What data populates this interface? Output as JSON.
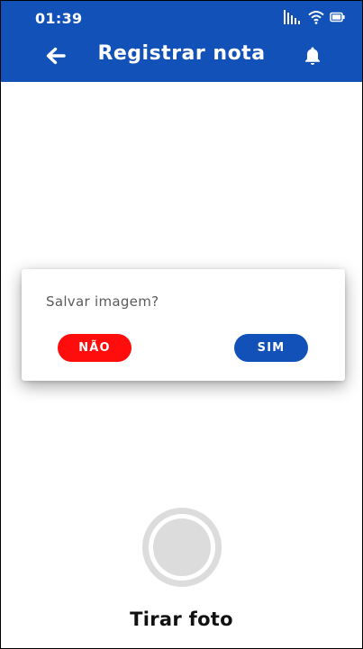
{
  "status_bar": {
    "time": "01:39",
    "icons": [
      "signal-icon",
      "wifi-icon",
      "battery-icon"
    ]
  },
  "app_bar": {
    "title": "Registrar nota",
    "back_icon": "arrow-left-icon",
    "notification_icon": "bell-icon",
    "background_color": "#1151b8"
  },
  "dialog": {
    "message": "Salvar imagem?",
    "buttons": {
      "no_label": "NÃO",
      "yes_label": "SIM"
    },
    "no_color": "#ff0d0d",
    "yes_color": "#1151b8"
  },
  "camera": {
    "capture_label": "Tirar foto",
    "shutter_icon": "shutter-button-icon"
  }
}
